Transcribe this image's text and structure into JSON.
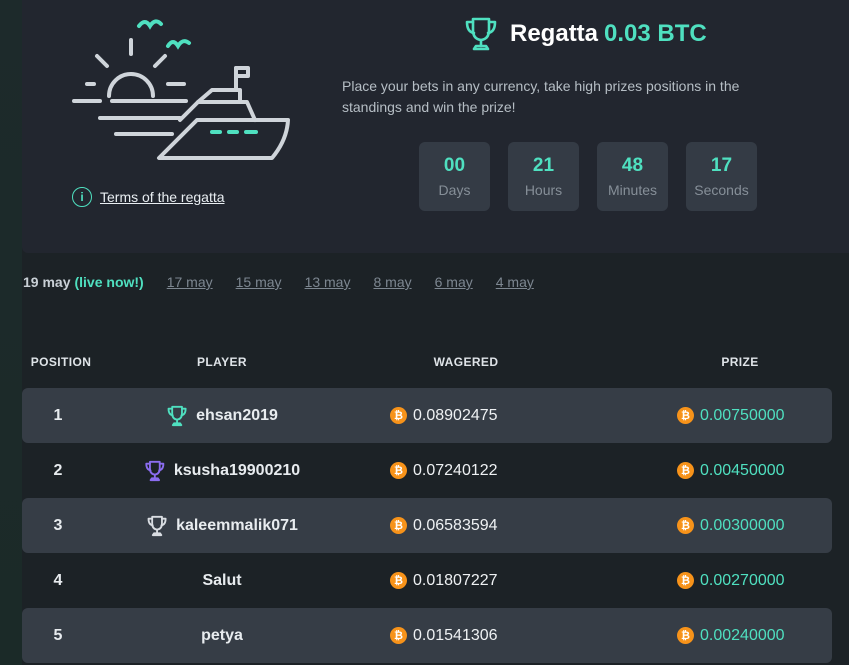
{
  "header": {
    "title_name": "Regatta",
    "title_prize": "0.03 BTC",
    "description": "Place your bets in any currency, take high prizes positions in the standings and win the prize!",
    "terms_link": "Terms of the regatta",
    "info_icon": "i"
  },
  "timer": [
    {
      "value": "00",
      "label": "Days"
    },
    {
      "value": "21",
      "label": "Hours"
    },
    {
      "value": "48",
      "label": "Minutes"
    },
    {
      "value": "17",
      "label": "Seconds"
    }
  ],
  "dates": {
    "current": "19 may",
    "live": "(live now!)",
    "past": [
      "17 may",
      "15 may",
      "13 may",
      "8 may",
      "6 may",
      "4 may"
    ]
  },
  "table": {
    "headers": {
      "position": "POSITION",
      "player": "PLAYER",
      "wagered": "WAGERED",
      "prize": "PRIZE"
    },
    "rows": [
      {
        "position": "1",
        "player": "ehsan2019",
        "wagered": "0.08902475",
        "prize": "0.00750000",
        "trophy": "gold-trophy-icon"
      },
      {
        "position": "2",
        "player": "ksusha19900210",
        "wagered": "0.07240122",
        "prize": "0.00450000",
        "trophy": "silver-trophy-icon"
      },
      {
        "position": "3",
        "player": "kaleemmalik071",
        "wagered": "0.06583594",
        "prize": "0.00300000",
        "trophy": "bronze-trophy-icon"
      },
      {
        "position": "4",
        "player": "Salut",
        "wagered": "0.01807227",
        "prize": "0.00270000",
        "trophy": ""
      },
      {
        "position": "5",
        "player": "petya",
        "wagered": "0.01541306",
        "prize": "0.00240000",
        "trophy": ""
      }
    ],
    "currency_symbol": "₿"
  },
  "colors": {
    "accent": "#4fe0c0",
    "trophy_1": "#4fe0c0",
    "trophy_2": "#8b6df0",
    "trophy_3": "#d9dde2",
    "btc": "#f7931a"
  }
}
